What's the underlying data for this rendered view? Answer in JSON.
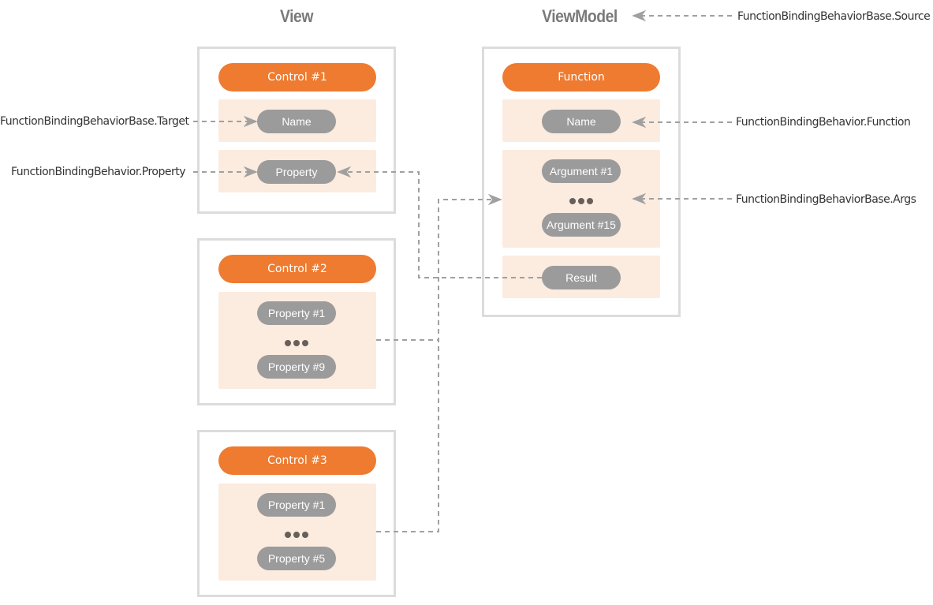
{
  "view": {
    "title": "View",
    "controls": [
      {
        "header": "Control #1",
        "name_pill": "Name",
        "property_pill": "Property"
      },
      {
        "header": "Control #2",
        "items": [
          "Property #1",
          "Property #9"
        ]
      },
      {
        "header": "Control #3",
        "items": [
          "Property #1",
          "Property #5"
        ]
      }
    ]
  },
  "viewmodel": {
    "title": "ViewModel",
    "header": "Function",
    "name_pill": "Name",
    "arguments": [
      "Argument #1",
      "Argument #15"
    ],
    "result_pill": "Result"
  },
  "annotations": {
    "source": "FunctionBindingBehaviorBase.Source",
    "target": "FunctionBindingBehaviorBase.Target",
    "property": "FunctionBindingBehavior.Property",
    "function": "FunctionBindingBehavior.Function",
    "args": "FunctionBindingBehaviorBase.Args"
  },
  "colors": {
    "accent": "#ee7b30",
    "panel": "#fcebdf",
    "pill": "#9b9b9b",
    "frame": "#dcdcdc",
    "connector": "#a0a0a0"
  }
}
